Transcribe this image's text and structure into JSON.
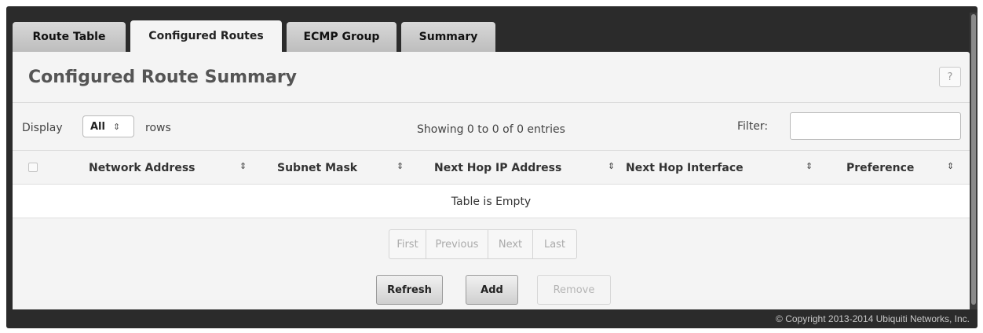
{
  "tabs": [
    {
      "label": "Route Table",
      "active": false
    },
    {
      "label": "Configured Routes",
      "active": true
    },
    {
      "label": "ECMP Group",
      "active": false
    },
    {
      "label": "Summary",
      "active": false
    }
  ],
  "page": {
    "title": "Configured Route Summary",
    "help_label": "?"
  },
  "controls": {
    "display_label": "Display",
    "rows_value": "All",
    "rows_label": "rows",
    "showing_text": "Showing 0 to 0 of 0 entries",
    "filter_label": "Filter:",
    "filter_value": ""
  },
  "table": {
    "columns": [
      "Network Address",
      "Subnet Mask",
      "Next Hop IP Address",
      "Next Hop Interface",
      "Preference"
    ],
    "empty_text": "Table is Empty"
  },
  "pager": {
    "first": "First",
    "previous": "Previous",
    "next": "Next",
    "last": "Last"
  },
  "buttons": {
    "refresh": "Refresh",
    "add": "Add",
    "remove": "Remove"
  },
  "footer": {
    "copyright": "© Copyright 2013-2014 Ubiquiti Networks, Inc."
  }
}
